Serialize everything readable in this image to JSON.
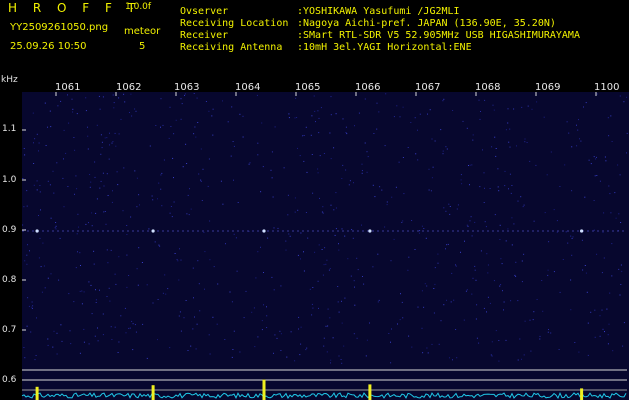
{
  "app": {
    "title": "H R O F F T",
    "version": "1.0.0f",
    "file_name": "YY2509261050.png",
    "timestamp": "25.09.26 10:50",
    "meteor_label": "meteor",
    "meteor_count": "5"
  },
  "header": {
    "rows": [
      {
        "key": "Ovserver",
        "value": ":YOSHIKAWA Yasufumi /JG2MLI"
      },
      {
        "key": "Receiving Location",
        "value": ":Nagoya Aichi-pref. JAPAN (136.90E, 35.20N)"
      },
      {
        "key": "Receiver",
        "value": ":SMart RTL-SDR V5 52.905MHz USB HIGASHIMURAYAMA"
      },
      {
        "key": "Receiving Antenna",
        "value": ":10mH 3el.YAGI Horizontal:ENE"
      }
    ]
  },
  "axis": {
    "unit": "kHz",
    "x_ticks": [
      "1061",
      "1062",
      "1063",
      "1064",
      "1065",
      "1066",
      "1067",
      "1068",
      "1069",
      "1100"
    ],
    "y_ticks": [
      "1.1",
      "1.0",
      "0.9",
      "0.8",
      "0.7",
      "0.6"
    ]
  },
  "colors": {
    "background": "#000000",
    "waterfall": "#07072e",
    "text_accent": "#f2f200",
    "spectrum": "#20c8e8",
    "meteor_ping": "#f0f020",
    "grid_line": "#d8d8d8"
  },
  "meteor_pings": [
    {
      "at_minute": 0.3,
      "strength": 0.45
    },
    {
      "at_minute": 2.6,
      "strength": 0.55
    },
    {
      "at_minute": 4.8,
      "strength": 0.9
    },
    {
      "at_minute": 6.9,
      "strength": 0.6
    },
    {
      "at_minute": 11.1,
      "strength": 0.35
    }
  ]
}
